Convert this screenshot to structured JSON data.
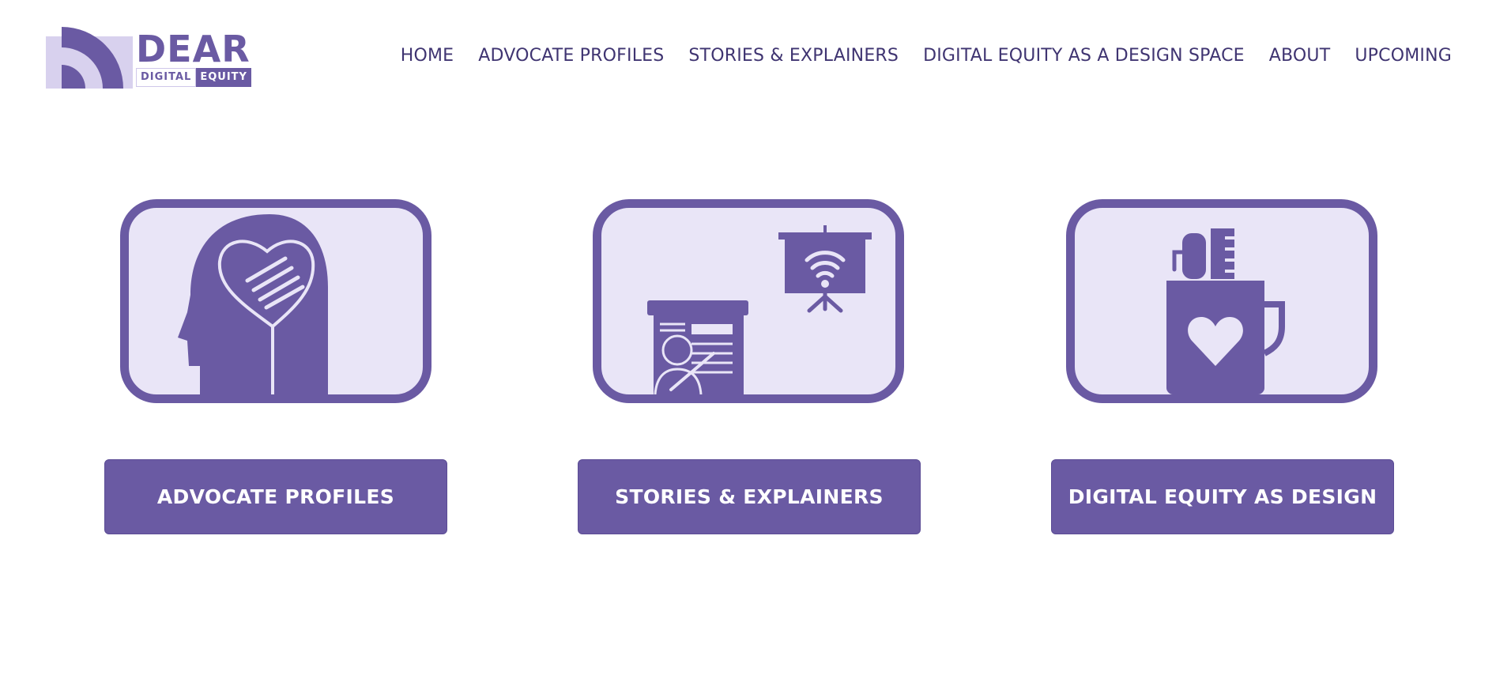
{
  "brand": {
    "name": "DEAR",
    "sub_left": "DIGITAL",
    "sub_right": "EQUITY"
  },
  "nav": {
    "items": [
      {
        "label": "HOME"
      },
      {
        "label": "ADVOCATE PROFILES"
      },
      {
        "label": "STORIES & EXPLAINERS"
      },
      {
        "label": "DIGITAL EQUITY AS A DESIGN SPACE"
      },
      {
        "label": "ABOUT"
      },
      {
        "label": "UPCOMING"
      }
    ]
  },
  "cards": [
    {
      "icon": "head-heart-handshake-icon",
      "button_label": "ADVOCATE PROFILES"
    },
    {
      "icon": "presentation-wifi-icon",
      "button_label": "STORIES & EXPLAINERS"
    },
    {
      "icon": "mug-heart-pencils-icon",
      "button_label": "DIGITAL EQUITY AS DESIGN"
    }
  ],
  "colors": {
    "brand": "#6a5aa3",
    "tile_bg": "#e9e5f7",
    "nav_text": "#3f3471",
    "button_text": "#ffffff"
  }
}
